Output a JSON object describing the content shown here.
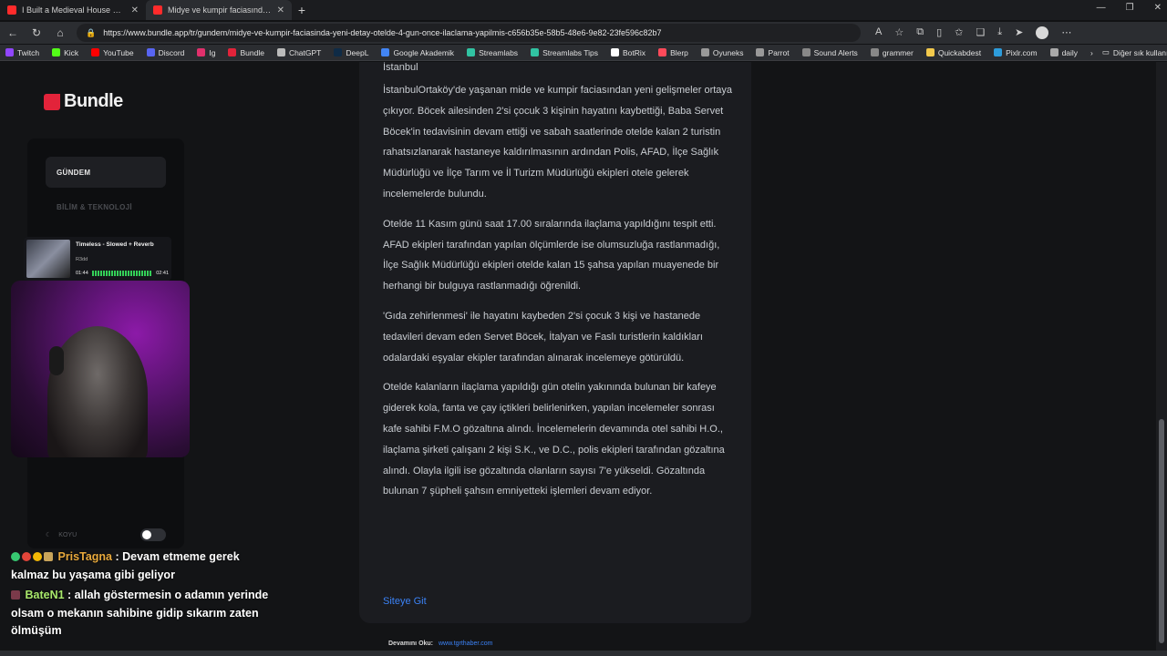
{
  "tabs": [
    {
      "title": "I Built a Medieval House Using Pr",
      "active": false
    },
    {
      "title": "Midye ve kumpir faciasında yeni g",
      "active": true
    }
  ],
  "address": {
    "url": "https://www.bundle.app/tr/gundem/midye-ve-kumpir-faciasinda-yeni-detay-otelde-4-gun-once-ilaclama-yapilmis-c656b35e-58b5-48e6-9e82-23fe596c82b7"
  },
  "bookmarks": [
    {
      "label": "Twitch",
      "color": "#9146ff"
    },
    {
      "label": "Kick",
      "color": "#53fc18"
    },
    {
      "label": "YouTube",
      "color": "#ff0000"
    },
    {
      "label": "Discord",
      "color": "#5865f2"
    },
    {
      "label": "Ig",
      "color": "#e1306c"
    },
    {
      "label": "Bundle",
      "color": "#e2233a"
    },
    {
      "label": "ChatGPT",
      "color": "#bbbbbb"
    },
    {
      "label": "DeepL",
      "color": "#0f2b46"
    },
    {
      "label": "Google Akademik",
      "color": "#4285f4"
    },
    {
      "label": "Streamlabs",
      "color": "#31c3a2"
    },
    {
      "label": "Streamlabs Tips",
      "color": "#31c3a2"
    },
    {
      "label": "BotRix",
      "color": "#ffffff"
    },
    {
      "label": "Blerp",
      "color": "#ff4a5a"
    },
    {
      "label": "Oyuneks",
      "color": "#999999"
    },
    {
      "label": "Parrot",
      "color": "#999999"
    },
    {
      "label": "Sound Alerts",
      "color": "#888888"
    },
    {
      "label": "grammer",
      "color": "#888888"
    },
    {
      "label": "Quickabdest",
      "color": "#f2c94c"
    },
    {
      "label": "Pixlr.com",
      "color": "#2d9cdb"
    },
    {
      "label": "daily",
      "color": "#aaaaaa"
    }
  ],
  "bookmarks_other": "Diğer sık kullanılanlar",
  "site": {
    "logo": "Bundle",
    "nav": [
      {
        "label": "GÜNDEM",
        "active": true
      },
      {
        "label": "BİLİM & TEKNOLOJİ",
        "active": false
      }
    ],
    "dark_mode_label": "KOYU"
  },
  "now_playing": {
    "title": "Timeless - Slowed + Reverb",
    "artist": "R3dd",
    "elapsed": "01:44",
    "total": "02:41"
  },
  "article": {
    "city": "İstanbul",
    "paragraphs": [
      "İstanbulOrtaköy'de yaşanan mide ve kumpir faciasından yeni gelişmeler ortaya çıkıyor. Böcek ailesinden 2'si çocuk 3 kişinin hayatını kaybettiği, Baba Servet Böcek'in tedavisinin devam ettiği ve sabah saatlerinde otelde kalan 2 turistin rahatsızlanarak hastaneye kaldırılmasının ardından Polis, AFAD, İlçe Sağlık Müdürlüğü ve İlçe Tarım ve İl Turizm Müdürlüğü ekipleri otele gelerek incelemelerde bulundu.",
      "Otelde 11 Kasım günü saat 17.00 sıralarında ilaçlama yapıldığını tespit etti. AFAD ekipleri tarafından yapılan ölçümlerde ise olumsuzluğa rastlanmadığı, İlçe Sağlık Müdürlüğü ekipleri otelde kalan 15 şahsa yapılan muayenede bir herhangi bir bulguya rastlanmadığı öğrenildi.",
      "'Gıda zehirlenmesi' ile hayatını kaybeden 2'si çocuk 3 kişi ve hastanede tedavileri devam eden Servet Böcek, İtalyan ve Faslı turistlerin kaldıkları odalardaki eşyalar ekipler tarafından alınarak incelemeye götürüldü.",
      "Otelde kalanların ilaçlama yapıldığı gün otelin yakınında bulunan bir kafeye giderek kola, fanta ve çay içtikleri belirlenirken, yapılan incelemeler sonrası kafe sahibi F.M.O gözaltına alındı. İncelemelerin devamında otel sahibi H.O., ilaçlama şirketi çalışanı 2 kişi S.K., ve D.C., polis ekipleri tarafından gözaltına alındı. Olayla ilgili ise gözaltında olanların sayısı 7'e yükseldi. Gözaltında bulunan 7 şüpheli şahsın emniyetteki işlemleri devam ediyor."
    ],
    "site_link": "Siteye Git",
    "read_more_label": "Devamını Oku:",
    "read_more_source": "www.tgrthaber.com"
  },
  "chat": [
    {
      "user": "PrisTagna",
      "text": ": Devam etmeme gerek kalmaz bu yaşama gibi geliyor"
    },
    {
      "user": "BateN1",
      "text": ": allah göstermesin o adamın yerinde olsam o mekanın sahibine gidip sıkarım zaten ölmüşüm"
    }
  ]
}
